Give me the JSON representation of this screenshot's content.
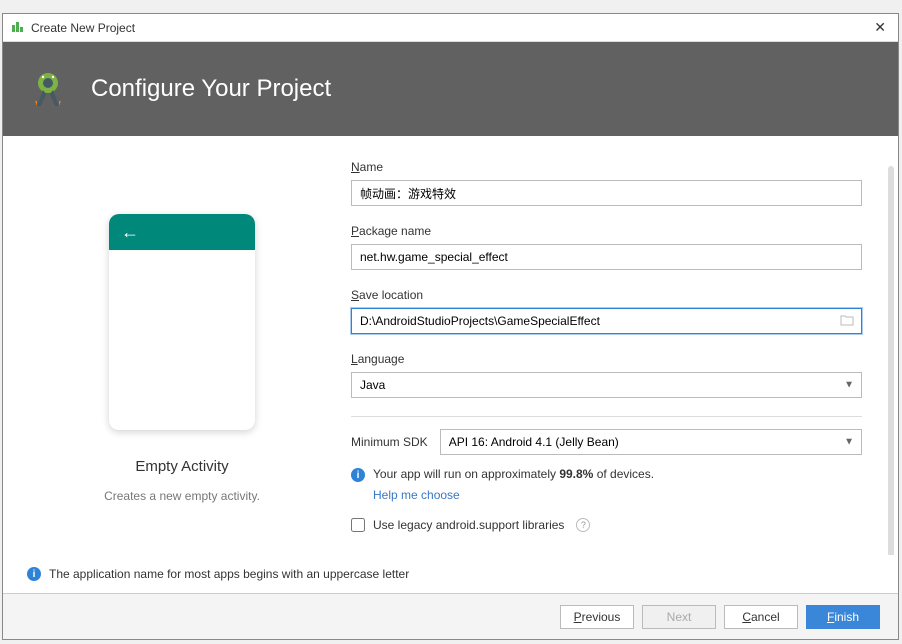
{
  "window": {
    "title": "Create New Project"
  },
  "header": {
    "title": "Configure Your Project"
  },
  "preview": {
    "title": "Empty Activity",
    "description": "Creates a new empty activity."
  },
  "form": {
    "name_label_prefix": "N",
    "name_label_rest": "ame",
    "name_value": "帧动画：游戏特效",
    "package_label_prefix": "P",
    "package_label_rest": "ackage name",
    "package_value": "net.hw.game_special_effect",
    "save_label_prefix": "S",
    "save_label_rest": "ave location",
    "save_value": "D:\\AndroidStudioProjects\\GameSpecialEffect",
    "language_label_prefix": "L",
    "language_label_rest": "anguage",
    "language_value": "Java",
    "min_sdk_label": "Minimum SDK",
    "min_sdk_value": "API 16: Android 4.1 (Jelly Bean)",
    "device_info_pre": "Your app will run on approximately ",
    "device_percent": "99.8%",
    "device_info_post": " of devices.",
    "help_link": "Help me choose",
    "legacy_checkbox": "Use legacy android.support libraries"
  },
  "bottom_info": "The application name for most apps begins with an uppercase letter",
  "footer": {
    "previous_prefix": "P",
    "previous_rest": "revious",
    "next": "Next",
    "cancel_prefix": "C",
    "cancel_rest": "ancel",
    "finish_prefix": "F",
    "finish_rest": "inish"
  }
}
